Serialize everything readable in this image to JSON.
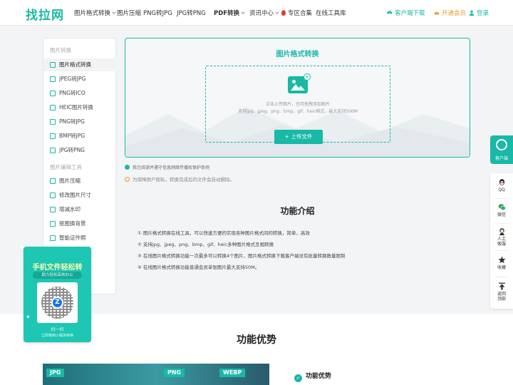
{
  "nav": {
    "logo": "找拉网",
    "items": [
      "图片格式转换",
      "图片压缩",
      "PNG转JPG",
      "JPG转PNG",
      "PDF转换",
      "资讯中心",
      "专区合集",
      "在线工具库"
    ],
    "download": "客户端下载",
    "vip": "开通会员",
    "login": "登录"
  },
  "sidebar": {
    "sec1": "图片转换",
    "sec1_items": [
      "图片格式转换",
      "JPEG转JPG",
      "PNG转ICO",
      "HEIC图片转换",
      "PNG转JPG",
      "BMP转JPG",
      "JPG转PNG"
    ],
    "sec2": "图片编辑工具",
    "sec2_items": [
      "图片压缩",
      "修改图片尺寸",
      "增减水印",
      "抠图换背景",
      "智能证件照"
    ]
  },
  "upload": {
    "title": "图片格式转换",
    "hint1": "点击上传图片，也可拖拽添加图片",
    "hint2": "支持jpg、jpeg、png、bmp、gif、heic格式，最大支持500M",
    "button": "上传文件"
  },
  "agree_text": "我已阅读并遵守信息网络传播权保护条例",
  "privacy_text": "为保障用户隐私，转换完成后的文件会自动删除。",
  "features": {
    "title": "功能介绍",
    "lines": [
      "① 图片格式转换在线工具，可以快速方便的实现各种图片格式间的转换，简单，高效",
      "② 支持jpg、jpeg、png、bmp、gif、heic多种图片格式互相转换",
      "③ 在线图片格式转换功能一次最多可以转换4个图片，图片格式转换下载客户端没有批量转换数量限制",
      "④ 在线图片格式转换功能普通会员单张图片最大支持50M。"
    ]
  },
  "advantages": {
    "title": "功能优势",
    "tags": [
      "JPG",
      "PNG",
      "WEBP"
    ],
    "check_label": "功能优势"
  },
  "promo": {
    "title": "手机文件轻松转",
    "subtitle": "助力轻松高效办公",
    "scan": "扫一扫",
    "scan_sub": "立即使用小程序转换"
  },
  "right_bar": {
    "cs": "客户端",
    "items": [
      "QQ",
      "微信",
      "人工客服",
      "收藏",
      "返回顶部"
    ]
  },
  "colors": {
    "accent": "#18b9a6",
    "vip": "#e89a2c",
    "hot": "#e53935"
  }
}
